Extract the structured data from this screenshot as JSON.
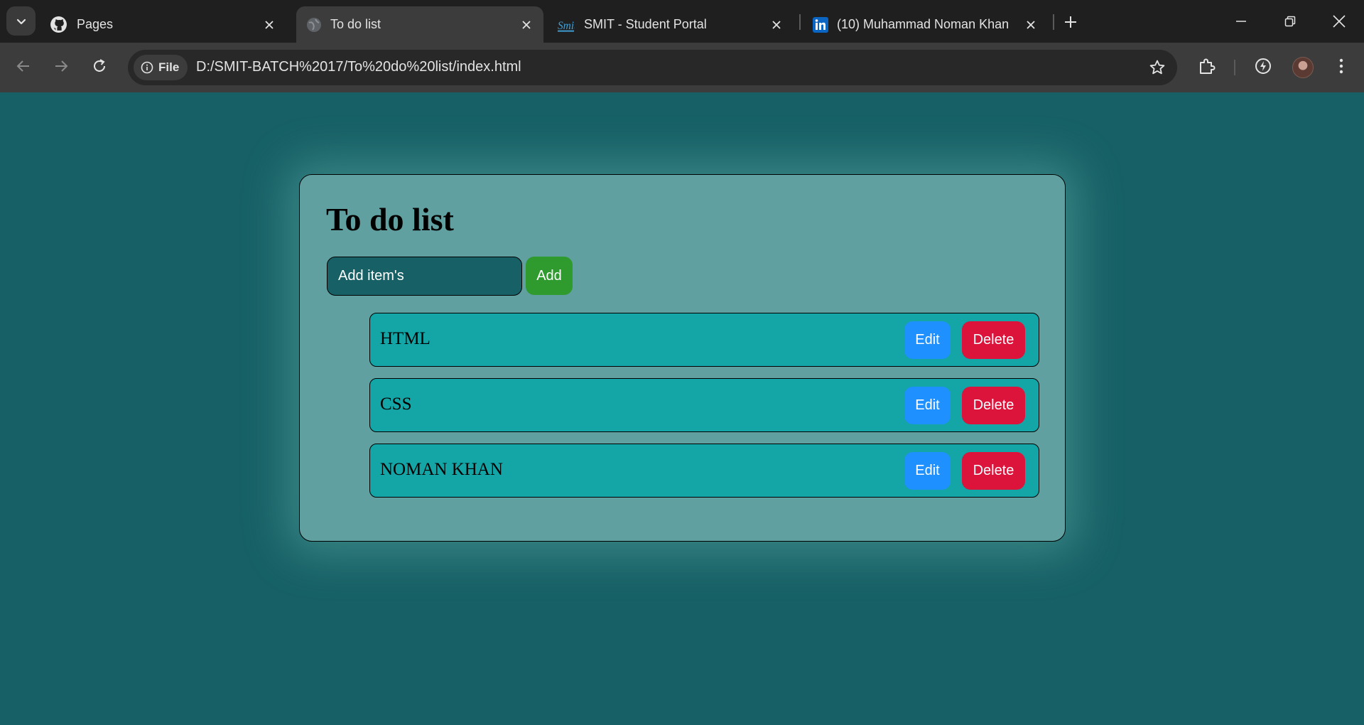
{
  "browser": {
    "tabs": [
      {
        "title": "Pages",
        "icon": "github-icon",
        "active": false
      },
      {
        "title": "To do list",
        "icon": "globe-icon",
        "active": true
      },
      {
        "title": "SMIT - Student Portal",
        "icon": "smit-logo-icon",
        "active": false
      },
      {
        "title": "(10) Muhammad Noman Khan |",
        "icon": "linkedin-icon",
        "active": false
      }
    ],
    "address": {
      "chip_label": "File",
      "url": "D:/SMIT-BATCH%2017/To%20do%20list/index.html"
    }
  },
  "app": {
    "title": "To do list",
    "input_placeholder": "Add item's",
    "add_label": "Add",
    "items": [
      {
        "label": "HTML",
        "edit_label": "Edit",
        "delete_label": "Delete"
      },
      {
        "label": "CSS",
        "edit_label": "Edit",
        "delete_label": "Delete"
      },
      {
        "label": "NOMAN KHAN",
        "edit_label": "Edit",
        "delete_label": "Delete"
      }
    ]
  },
  "colors": {
    "page_bg": "#176166",
    "card_bg": "#60a0a1",
    "item_bg": "#14a5a6",
    "add_button": "#2f9a2d",
    "edit_button": "#1e90ff",
    "delete_button": "#dc143c"
  }
}
